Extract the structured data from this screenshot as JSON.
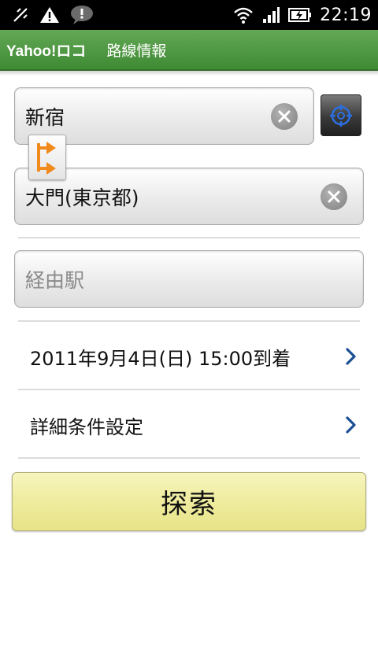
{
  "status_bar": {
    "time": "22:19",
    "icons": [
      "usb-debug-icon",
      "warning-icon",
      "chat-bubble-icon",
      "wifi-icon",
      "signal-icon",
      "battery-charging-icon"
    ]
  },
  "app_bar": {
    "logo": "Yahoo!ロコ",
    "title": "路線情報"
  },
  "form": {
    "from_value": "新宿",
    "to_value": "大門(東京都)",
    "via_placeholder": "経由駅",
    "datetime_label": "2011年9月4日(日) 15:00到着",
    "conditions_label": "詳細条件設定",
    "search_label": "探索"
  },
  "colors": {
    "app_bar": "#4f9a43",
    "search_button": "#eeeb9c",
    "chevron": "#1b4f93",
    "swap_arrow": "#f08a1c"
  }
}
